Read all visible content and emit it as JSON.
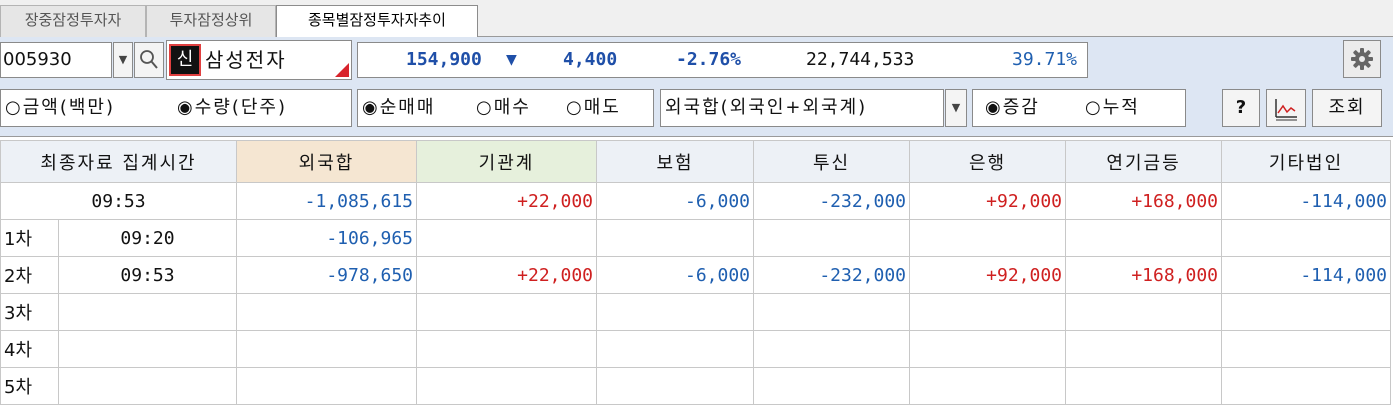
{
  "tabs": [
    "장중잠정투자자",
    "투자잠정상위",
    "종목별잠정투자자추이"
  ],
  "stock": {
    "code": "005930",
    "badge": "신",
    "name": "삼성전자",
    "price": "154,900",
    "change_arrow": "▼",
    "change": "4,400",
    "change_rate": "-2.76%",
    "volume": "22,744,533",
    "ratio": "39.71%"
  },
  "options": {
    "amount": "○금액(백만)",
    "quantity": "◉수량(단주)",
    "net_buy": "◉순매매",
    "buy": "○매수",
    "sell": "○매도",
    "investor_combo": "외국합(외국인+외국계)",
    "change_opt": "◉증감",
    "cumulative_opt": "○누적",
    "help_label": "?",
    "query_label": "조회"
  },
  "colors": {
    "negative": "#1f5fb0",
    "positive": "#cf2020",
    "header_bg": "#edf1f6",
    "panel_bg": "#dde6f3"
  },
  "table": {
    "headers": [
      "최종자료 집계시간",
      "외국합",
      "기관계",
      "보험",
      "투신",
      "은행",
      "연기금등",
      "기타법인"
    ],
    "summary": {
      "time": "09:53",
      "values": [
        "-1,085,615",
        "+22,000",
        "-6,000",
        "-232,000",
        "+92,000",
        "+168,000",
        "-114,000"
      ]
    },
    "rows": [
      {
        "label": "1차",
        "time": "09:20",
        "values": [
          "-106,965",
          "",
          "",
          "",
          "",
          "",
          ""
        ]
      },
      {
        "label": "2차",
        "time": "09:53",
        "values": [
          "-978,650",
          "+22,000",
          "-6,000",
          "-232,000",
          "+92,000",
          "+168,000",
          "-114,000"
        ]
      },
      {
        "label": "3차",
        "time": "",
        "values": [
          "",
          "",
          "",
          "",
          "",
          "",
          ""
        ]
      },
      {
        "label": "4차",
        "time": "",
        "values": [
          "",
          "",
          "",
          "",
          "",
          "",
          ""
        ]
      },
      {
        "label": "5차",
        "time": "",
        "values": [
          "",
          "",
          "",
          "",
          "",
          "",
          ""
        ]
      }
    ]
  }
}
